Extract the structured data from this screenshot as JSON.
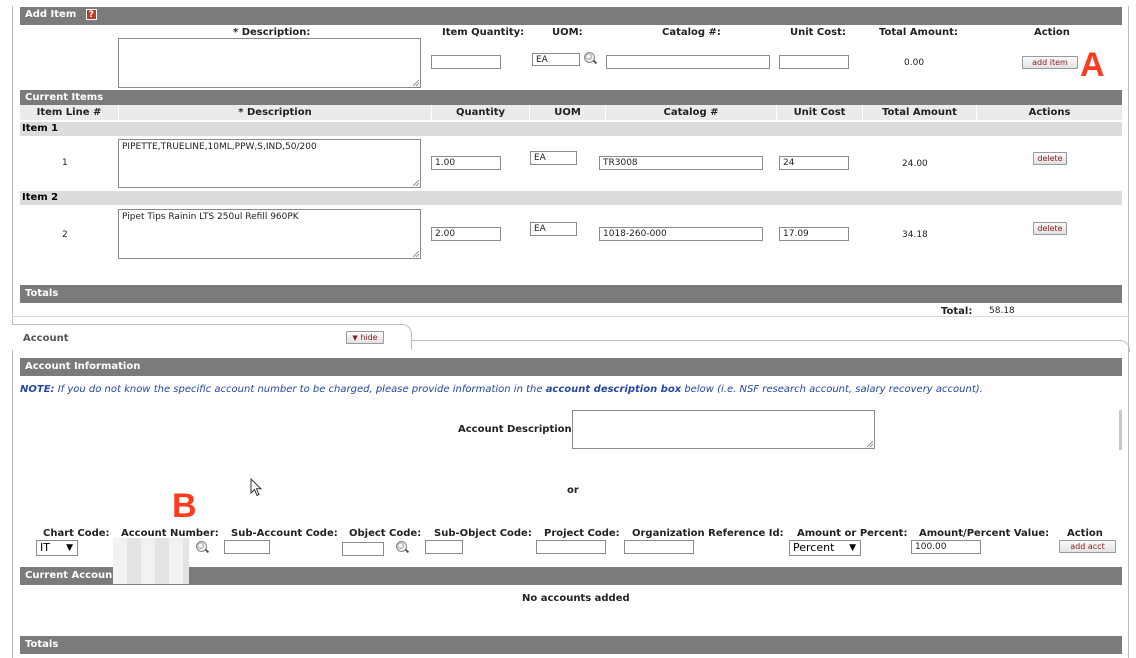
{
  "add_item": {
    "title": "Add Item",
    "help_icon": "help-icon",
    "headers": {
      "description": "* Description:",
      "quantity": "Item Quantity:",
      "uom": "UOM:",
      "catalog": "Catalog #:",
      "unit_cost": "Unit Cost:",
      "total_amount": "Total Amount:",
      "action": "Action"
    },
    "values": {
      "description": "",
      "quantity": "",
      "uom": "EA",
      "catalog": "",
      "unit_cost": "",
      "total": "0.00"
    },
    "add_button": "add item"
  },
  "current_items": {
    "title": "Current Items",
    "columns": {
      "line": "Item Line #",
      "description": "* Description",
      "quantity": "Quantity",
      "uom": "UOM",
      "catalog": "Catalog #",
      "unit_cost": "Unit Cost",
      "total": "Total Amount",
      "actions": "Actions"
    },
    "items": [
      {
        "label": "Item 1",
        "line": "1",
        "description": "PIPETTE,TRUELINE,10ML,PPW,S,IND,50/200",
        "quantity": "1.00",
        "uom": "EA",
        "catalog": "TR3008",
        "unit_cost": "24",
        "total": "24.00",
        "delete": "delete"
      },
      {
        "label": "Item 2",
        "line": "2",
        "description": "Pipet Tips Rainin LTS 250ul Refill 960PK",
        "quantity": "2.00",
        "uom": "EA",
        "catalog": "1018-260-000",
        "unit_cost": "17.09",
        "total": "34.18",
        "delete": "delete"
      }
    ]
  },
  "totals": {
    "title": "Totals",
    "label": "Total:",
    "value": "58.18"
  },
  "account_tab": {
    "title": "Account",
    "hide_button": "hide"
  },
  "account_info": {
    "title": "Account Information",
    "note_prefix": "NOTE:",
    "note_text": " If you do not know the specific account number to be charged, please provide information in the ",
    "note_bold": "account description box",
    "note_suffix": " below (i.e. NSF research account, salary recovery account).",
    "description_label": "Account Description:",
    "or": "or",
    "headers": {
      "chart": "Chart Code:",
      "account": "Account Number:",
      "sub_account": "Sub-Account Code:",
      "object": "Object Code:",
      "sub_object": "Sub-Object Code:",
      "project": "Project Code:",
      "org_ref": "Organization Reference Id:",
      "amount_or_percent": "Amount or Percent:",
      "amount_value": "Amount/Percent Value:",
      "action": "Action"
    },
    "chart_value": "IT",
    "amount_type": "Percent",
    "amount_value": "100.00",
    "add_button": "add acct"
  },
  "current_accounts": {
    "title": "Current Accoun",
    "empty": "No accounts added"
  },
  "account_totals": {
    "title": "Totals"
  },
  "markers": {
    "a": "A",
    "b": "B"
  }
}
